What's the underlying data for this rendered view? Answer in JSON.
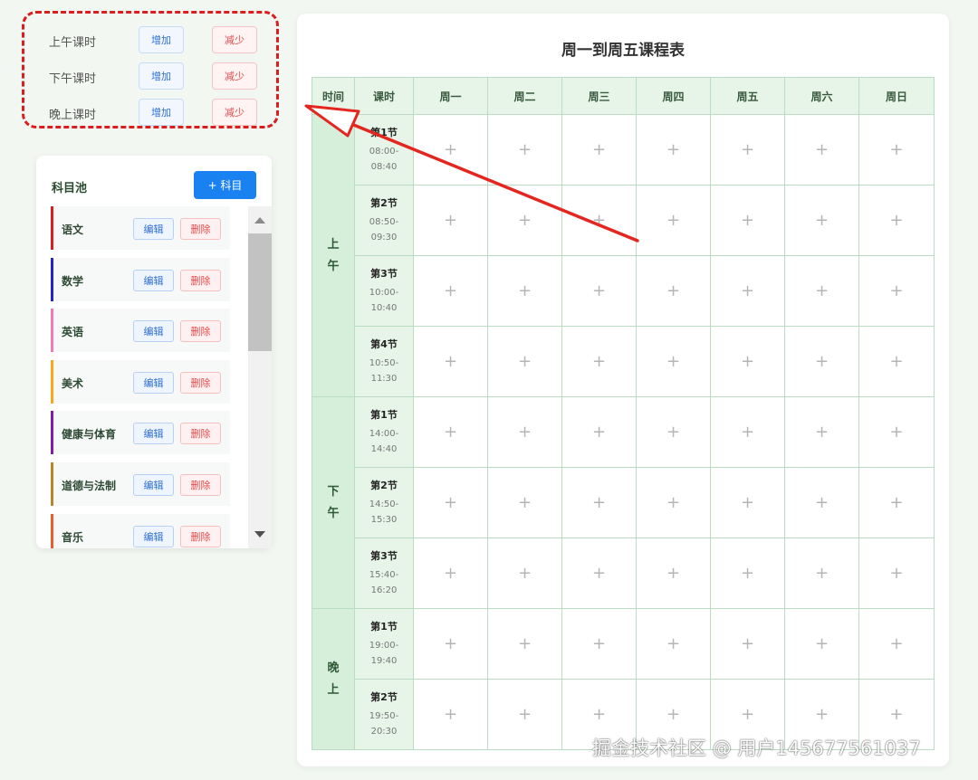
{
  "period_controls": [
    {
      "label": "上午课时",
      "add_label": "增加",
      "sub_label": "减少"
    },
    {
      "label": "下午课时",
      "add_label": "增加",
      "sub_label": "减少"
    },
    {
      "label": "晚上课时",
      "add_label": "增加",
      "sub_label": "减少"
    }
  ],
  "subject_pool": {
    "title": "科目池",
    "add_label": "+ 科目",
    "items": [
      {
        "name": "语文",
        "color": "#d81e1e",
        "edit_label": "编辑",
        "delete_label": "删除"
      },
      {
        "name": "数学",
        "color": "#2622c4",
        "edit_label": "编辑",
        "delete_label": "删除"
      },
      {
        "name": "英语",
        "color": "#f07ab4",
        "edit_label": "编辑",
        "delete_label": "删除"
      },
      {
        "name": "美术",
        "color": "#f2a91c",
        "edit_label": "编辑",
        "delete_label": "删除"
      },
      {
        "name": "健康与体育",
        "color": "#7c1ea6",
        "edit_label": "编辑",
        "delete_label": "删除"
      },
      {
        "name": "道德与法制",
        "color": "#b8862a",
        "edit_label": "编辑",
        "delete_label": "删除"
      },
      {
        "name": "音乐",
        "color": "#ea5e2c",
        "edit_label": "编辑",
        "delete_label": "删除"
      }
    ]
  },
  "timetable": {
    "title": "周一到周五课程表",
    "headers": [
      "时间",
      "课时",
      "周一",
      "周二",
      "周三",
      "周四",
      "周五",
      "周六",
      "周日"
    ],
    "add_symbol": "+",
    "slots": [
      {
        "label": "上午",
        "periods": [
          {
            "name": "第1节",
            "time": "08:00-\n08:40"
          },
          {
            "name": "第2节",
            "time": "08:50-\n09:30"
          },
          {
            "name": "第3节",
            "time": "10:00-\n10:40"
          },
          {
            "name": "第4节",
            "time": "10:50-\n11:30"
          }
        ]
      },
      {
        "label": "下午",
        "periods": [
          {
            "name": "第1节",
            "time": "14:00-\n14:40"
          },
          {
            "name": "第2节",
            "time": "14:50-\n15:30"
          },
          {
            "name": "第3节",
            "time": "15:40-\n16:20"
          }
        ]
      },
      {
        "label": "晚上",
        "periods": [
          {
            "name": "第1节",
            "time": "19:00-\n19:40"
          },
          {
            "name": "第2节",
            "time": "19:50-\n20:30"
          }
        ]
      }
    ]
  },
  "colors": {
    "highlight": "#d81e1e",
    "primary_button": "#1a82f0",
    "header_bg": "#e6f5e8",
    "slot_bg": "#d6efdb"
  },
  "watermark": "掘金技术社区 @ 用户1456775610​37"
}
